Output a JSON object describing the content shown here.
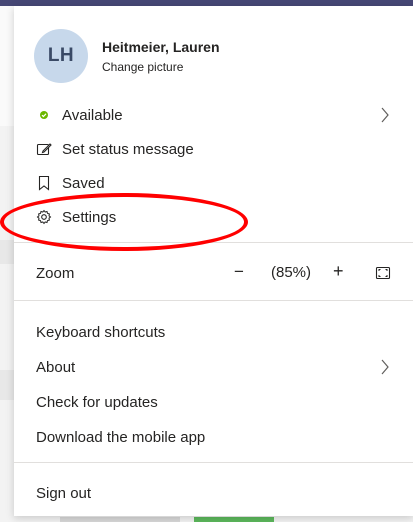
{
  "profile": {
    "initials": "LH",
    "name": "Heitmeier, Lauren",
    "change_picture": "Change picture"
  },
  "status_items": [
    {
      "label": "Available",
      "icon": "available-status-dot"
    },
    {
      "label": "Set status message",
      "icon": "edit-status-icon"
    },
    {
      "label": "Saved",
      "icon": "bookmark-icon"
    },
    {
      "label": "Settings",
      "icon": "gear-icon"
    }
  ],
  "zoom": {
    "label": "Zoom",
    "minus": "−",
    "value": "(85%)",
    "plus": "+"
  },
  "help_items": [
    {
      "label": "Keyboard shortcuts"
    },
    {
      "label": "About"
    },
    {
      "label": "Check for updates"
    },
    {
      "label": "Download the mobile app"
    }
  ],
  "sign_out": "Sign out",
  "colors": {
    "available": "#6bb700",
    "annotation": "#ff0000",
    "avatar_bg": "#c7d8eb"
  }
}
